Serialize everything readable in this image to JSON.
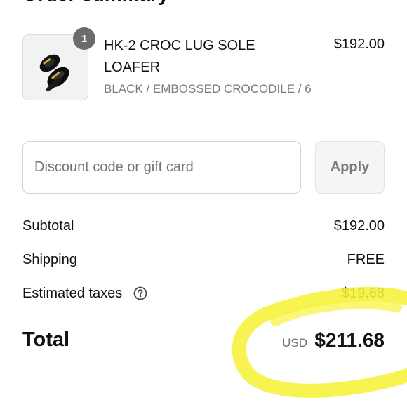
{
  "section_title": "Order summary",
  "product": {
    "quantity": "1",
    "name": "HK-2 CROC LUG SOLE LOAFER",
    "variant": "BLACK / EMBOSSED CROCODILE / 6",
    "price": "$192.00"
  },
  "discount": {
    "placeholder": "Discount code or gift card",
    "apply_label": "Apply"
  },
  "summary": {
    "subtotal_label": "Subtotal",
    "subtotal_value": "$192.00",
    "shipping_label": "Shipping",
    "shipping_value": "FREE",
    "taxes_label": "Estimated taxes",
    "taxes_value": "$19.68"
  },
  "total": {
    "label": "Total",
    "currency": "USD",
    "value": "$211.68"
  },
  "colors": {
    "highlight": "#f6f33a",
    "badge": "#6b6b6b",
    "muted_text": "#7a7a7a"
  },
  "icons": {
    "help": "question-circle-icon",
    "product_image": "loafer-shoes-image"
  }
}
